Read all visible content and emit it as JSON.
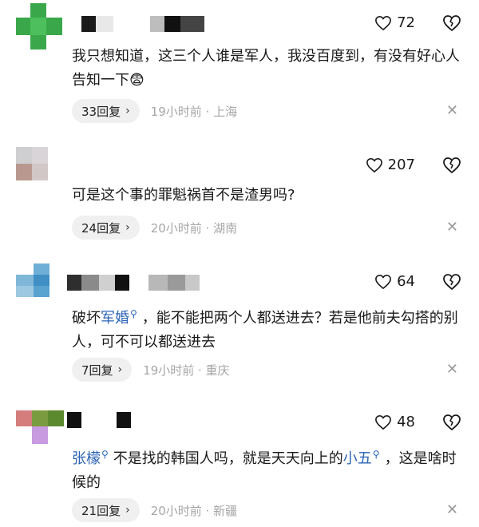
{
  "comments": [
    {
      "likes": "72",
      "text": "我只想知道，这三个人谁是军人，我没百度到，有没有好心人告知一下",
      "emoji": "😨",
      "reply_label": "33回复",
      "meta": "19小时前 · 上海"
    },
    {
      "likes": "207",
      "text": "可是这个事的罪魁祸首不是渣男吗?",
      "reply_label": "24回复",
      "meta": "20小时前 · 湖南"
    },
    {
      "likes": "64",
      "link": "军婚",
      "text_before": "破坏",
      "text_after": "，能不能把两个人都送进去？若是他前夫勾搭的别人，可不可以都送进去",
      "reply_label": "7回复",
      "meta": "19小时前 · 重庆"
    },
    {
      "likes": "48",
      "link1": "张檬",
      "text_mid": "不是找的韩国人吗，就是天天向上的",
      "link2": "小五",
      "text_after": "，这是啥时候的",
      "reply_label": "21回复",
      "meta": "20小时前 · 新疆"
    }
  ],
  "icons": {
    "like": "heart-outline-icon",
    "dislike": "broken-heart-icon",
    "chevron": "chevron-right-icon",
    "close": "close-icon",
    "search_link": "search-link-icon"
  },
  "colors": {
    "link": "#2a63b6",
    "meta": "#a6a6a6",
    "reply_bg": "#f0f0f0"
  }
}
